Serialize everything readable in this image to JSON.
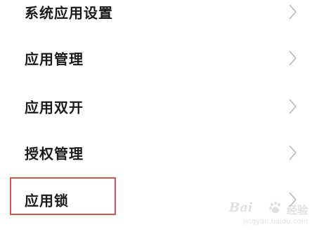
{
  "settings": {
    "items": [
      {
        "label": "系统应用设置"
      },
      {
        "label": "应用管理"
      },
      {
        "label": "应用双开"
      },
      {
        "label": "授权管理"
      },
      {
        "label": "应用锁"
      }
    ],
    "highlighted_item": "应用锁"
  },
  "watermark": {
    "brand": "Bai",
    "brand_cn": "经验",
    "url": "jingyan.baidu.com"
  },
  "colors": {
    "text": "#1a1a1a",
    "chevron": "#b8b8b8",
    "highlight": "#d9534f",
    "background": "#ffffff"
  }
}
